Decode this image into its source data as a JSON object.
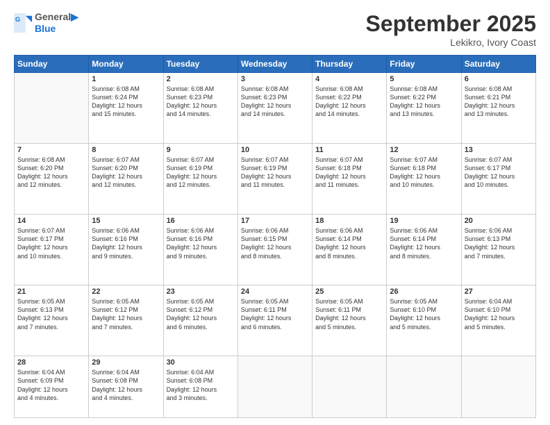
{
  "logo": {
    "line1": "General",
    "line2": "Blue"
  },
  "title": "September 2025",
  "location": "Lekikro, Ivory Coast",
  "days": [
    "Sunday",
    "Monday",
    "Tuesday",
    "Wednesday",
    "Thursday",
    "Friday",
    "Saturday"
  ],
  "weeks": [
    [
      {
        "date": "",
        "info": ""
      },
      {
        "date": "1",
        "info": "Sunrise: 6:08 AM\nSunset: 6:24 PM\nDaylight: 12 hours\nand 15 minutes."
      },
      {
        "date": "2",
        "info": "Sunrise: 6:08 AM\nSunset: 6:23 PM\nDaylight: 12 hours\nand 14 minutes."
      },
      {
        "date": "3",
        "info": "Sunrise: 6:08 AM\nSunset: 6:23 PM\nDaylight: 12 hours\nand 14 minutes."
      },
      {
        "date": "4",
        "info": "Sunrise: 6:08 AM\nSunset: 6:22 PM\nDaylight: 12 hours\nand 14 minutes."
      },
      {
        "date": "5",
        "info": "Sunrise: 6:08 AM\nSunset: 6:22 PM\nDaylight: 12 hours\nand 13 minutes."
      },
      {
        "date": "6",
        "info": "Sunrise: 6:08 AM\nSunset: 6:21 PM\nDaylight: 12 hours\nand 13 minutes."
      }
    ],
    [
      {
        "date": "7",
        "info": "Sunrise: 6:08 AM\nSunset: 6:20 PM\nDaylight: 12 hours\nand 12 minutes."
      },
      {
        "date": "8",
        "info": "Sunrise: 6:07 AM\nSunset: 6:20 PM\nDaylight: 12 hours\nand 12 minutes."
      },
      {
        "date": "9",
        "info": "Sunrise: 6:07 AM\nSunset: 6:19 PM\nDaylight: 12 hours\nand 12 minutes."
      },
      {
        "date": "10",
        "info": "Sunrise: 6:07 AM\nSunset: 6:19 PM\nDaylight: 12 hours\nand 11 minutes."
      },
      {
        "date": "11",
        "info": "Sunrise: 6:07 AM\nSunset: 6:18 PM\nDaylight: 12 hours\nand 11 minutes."
      },
      {
        "date": "12",
        "info": "Sunrise: 6:07 AM\nSunset: 6:18 PM\nDaylight: 12 hours\nand 10 minutes."
      },
      {
        "date": "13",
        "info": "Sunrise: 6:07 AM\nSunset: 6:17 PM\nDaylight: 12 hours\nand 10 minutes."
      }
    ],
    [
      {
        "date": "14",
        "info": "Sunrise: 6:07 AM\nSunset: 6:17 PM\nDaylight: 12 hours\nand 10 minutes."
      },
      {
        "date": "15",
        "info": "Sunrise: 6:06 AM\nSunset: 6:16 PM\nDaylight: 12 hours\nand 9 minutes."
      },
      {
        "date": "16",
        "info": "Sunrise: 6:06 AM\nSunset: 6:16 PM\nDaylight: 12 hours\nand 9 minutes."
      },
      {
        "date": "17",
        "info": "Sunrise: 6:06 AM\nSunset: 6:15 PM\nDaylight: 12 hours\nand 8 minutes."
      },
      {
        "date": "18",
        "info": "Sunrise: 6:06 AM\nSunset: 6:14 PM\nDaylight: 12 hours\nand 8 minutes."
      },
      {
        "date": "19",
        "info": "Sunrise: 6:06 AM\nSunset: 6:14 PM\nDaylight: 12 hours\nand 8 minutes."
      },
      {
        "date": "20",
        "info": "Sunrise: 6:06 AM\nSunset: 6:13 PM\nDaylight: 12 hours\nand 7 minutes."
      }
    ],
    [
      {
        "date": "21",
        "info": "Sunrise: 6:05 AM\nSunset: 6:13 PM\nDaylight: 12 hours\nand 7 minutes."
      },
      {
        "date": "22",
        "info": "Sunrise: 6:05 AM\nSunset: 6:12 PM\nDaylight: 12 hours\nand 7 minutes."
      },
      {
        "date": "23",
        "info": "Sunrise: 6:05 AM\nSunset: 6:12 PM\nDaylight: 12 hours\nand 6 minutes."
      },
      {
        "date": "24",
        "info": "Sunrise: 6:05 AM\nSunset: 6:11 PM\nDaylight: 12 hours\nand 6 minutes."
      },
      {
        "date": "25",
        "info": "Sunrise: 6:05 AM\nSunset: 6:11 PM\nDaylight: 12 hours\nand 5 minutes."
      },
      {
        "date": "26",
        "info": "Sunrise: 6:05 AM\nSunset: 6:10 PM\nDaylight: 12 hours\nand 5 minutes."
      },
      {
        "date": "27",
        "info": "Sunrise: 6:04 AM\nSunset: 6:10 PM\nDaylight: 12 hours\nand 5 minutes."
      }
    ],
    [
      {
        "date": "28",
        "info": "Sunrise: 6:04 AM\nSunset: 6:09 PM\nDaylight: 12 hours\nand 4 minutes."
      },
      {
        "date": "29",
        "info": "Sunrise: 6:04 AM\nSunset: 6:08 PM\nDaylight: 12 hours\nand 4 minutes."
      },
      {
        "date": "30",
        "info": "Sunrise: 6:04 AM\nSunset: 6:08 PM\nDaylight: 12 hours\nand 3 minutes."
      },
      {
        "date": "",
        "info": ""
      },
      {
        "date": "",
        "info": ""
      },
      {
        "date": "",
        "info": ""
      },
      {
        "date": "",
        "info": ""
      }
    ]
  ]
}
